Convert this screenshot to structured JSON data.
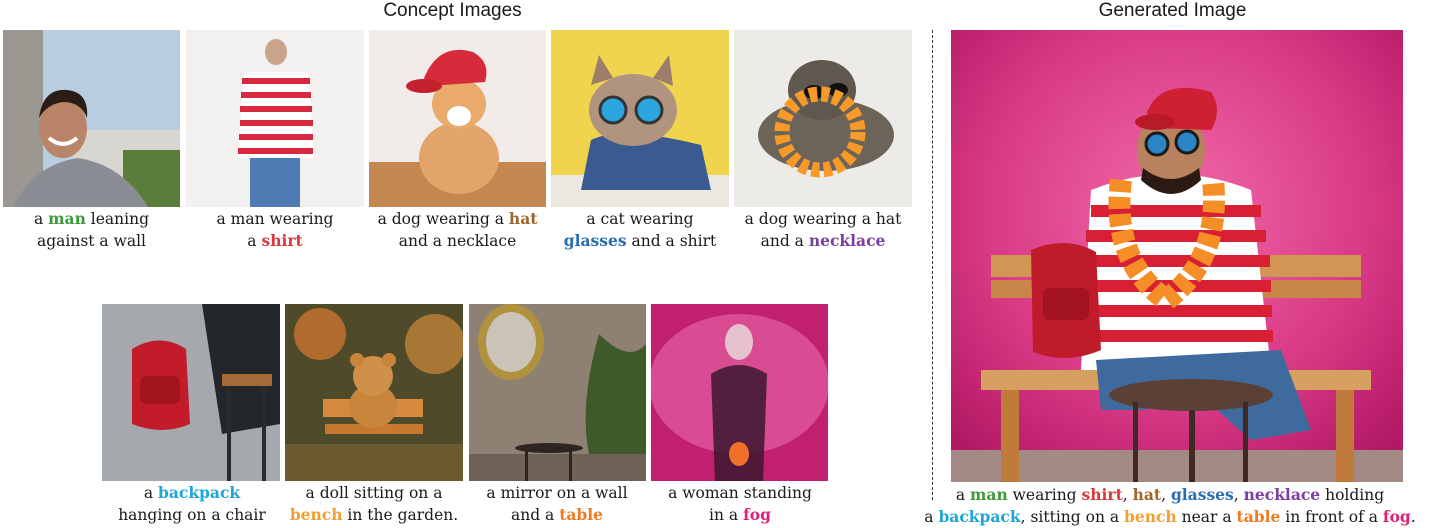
{
  "headings": {
    "concept": "Concept Images",
    "generated": "Generated Image"
  },
  "colors": {
    "man": "#3d9a3a",
    "shirt": "#d93a3a",
    "hat": "#a0642c",
    "glasses": "#2a6db5",
    "necklace": "#7b3fa0",
    "backpack": "#1ea7d6",
    "bench": "#f0a030",
    "table": "#f07a20",
    "fog": "#e01f7a"
  },
  "concepts": [
    {
      "line1_pre": "a ",
      "line1_kw": "man",
      "line1_post": " leaning",
      "line2_pre": "against a wall",
      "line2_kw": "",
      "line2_post": "",
      "image": "man-photo"
    },
    {
      "line1_pre": "a man wearing",
      "line1_kw": "",
      "line1_post": "",
      "line2_pre": "a ",
      "line2_kw": "shirt",
      "line2_post": "",
      "image": "striped-shirt-photo"
    },
    {
      "line1_pre": "a dog wearing a ",
      "line1_kw": "hat",
      "line1_post": "",
      "line2_pre": "and a necklace",
      "line2_kw": "",
      "line2_post": "",
      "image": "dog-hat-photo"
    },
    {
      "line1_pre": "a cat wearing",
      "line1_kw": "",
      "line1_post": "",
      "line2_pre": "",
      "line2_kw": "glasses",
      "line2_post": " and a shirt",
      "image": "cat-glasses-photo"
    },
    {
      "line1_pre": "a dog wearing a hat",
      "line1_kw": "",
      "line1_post": "",
      "line2_pre": "and a ",
      "line2_kw": "necklace",
      "line2_post": "",
      "image": "dog-necklace-photo"
    },
    {
      "line1_pre": "a ",
      "line1_kw": "backpack",
      "line1_post": "",
      "line2_pre": "hanging on a chair",
      "line2_kw": "",
      "line2_post": "",
      "image": "backpack-photo"
    },
    {
      "line1_pre": "a doll sitting on a",
      "line1_kw": "",
      "line1_post": "",
      "line2_pre": "",
      "line2_kw": "bench",
      "line2_post": " in the garden.",
      "image": "teddy-bench-photo"
    },
    {
      "line1_pre": "a mirror on a wall",
      "line1_kw": "",
      "line1_post": "",
      "line2_pre": "and a ",
      "line2_kw": "table",
      "line2_post": "",
      "image": "mirror-table-photo"
    },
    {
      "line1_pre": "a woman standing",
      "line1_kw": "",
      "line1_post": "",
      "line2_pre": "in a ",
      "line2_kw": "fog",
      "line2_post": "",
      "image": "woman-fog-photo"
    }
  ],
  "generated_caption": {
    "l1_a": "a ",
    "l1_man": "man",
    "l1_b": " wearing ",
    "l1_shirt": "shirt",
    "l1_c": ", ",
    "l1_hat": "hat",
    "l1_d": ", ",
    "l1_glasses": "glasses",
    "l1_e": ", ",
    "l1_necklace": "necklace",
    "l1_f": " holding",
    "l2_a": "a ",
    "l2_backpack": "backpack",
    "l2_b": ", sitting on a ",
    "l2_bench": "bench",
    "l2_c": " near a ",
    "l2_table": "table",
    "l2_d": " in front of  a ",
    "l2_fog": "fog",
    "l2_e": "."
  }
}
